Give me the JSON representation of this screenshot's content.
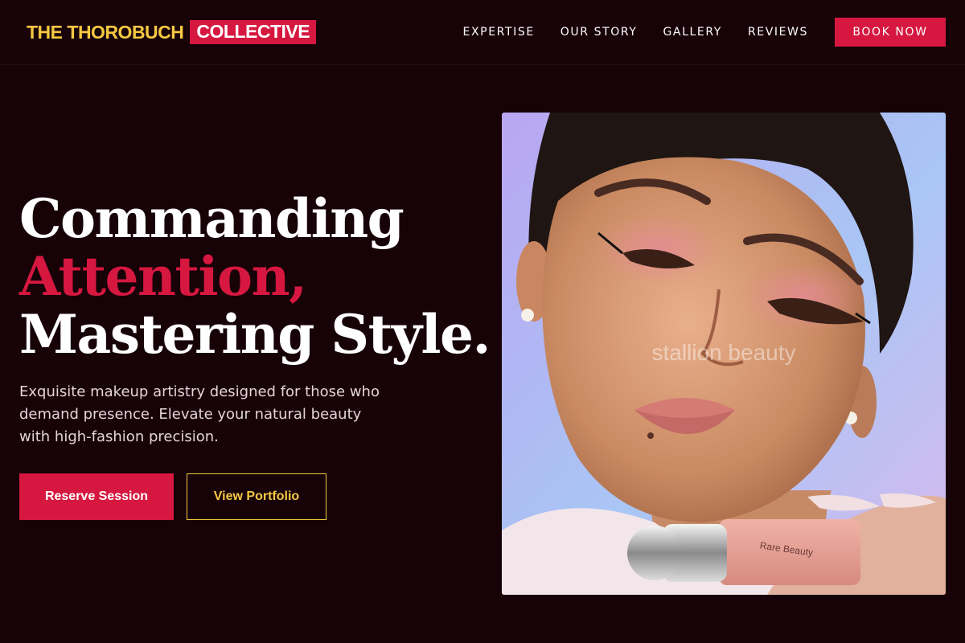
{
  "header": {
    "brand_main": "THE THOROBUCH",
    "brand_accent": "COLLECTIVE",
    "nav": [
      "EXPERTISE",
      "OUR STORY",
      "GALLERY",
      "REVIEWS"
    ],
    "book_label": "BOOK NOW"
  },
  "hero": {
    "headline_line1": "Commanding",
    "headline_line2": "Attention,",
    "headline_line3": "Mastering Style.",
    "subtitle": "Exquisite makeup artistry designed for those who demand presence. Elevate your natural beauty with high-fashion precision.",
    "primary_cta": "Reserve Session",
    "secondary_cta": "View Portfolio"
  },
  "photo": {
    "watermark": "stallion beauty",
    "product_label": "Rare Beauty"
  },
  "colors": {
    "background": "#170208",
    "accent": "#d6173f",
    "gold": "#f5c842"
  }
}
